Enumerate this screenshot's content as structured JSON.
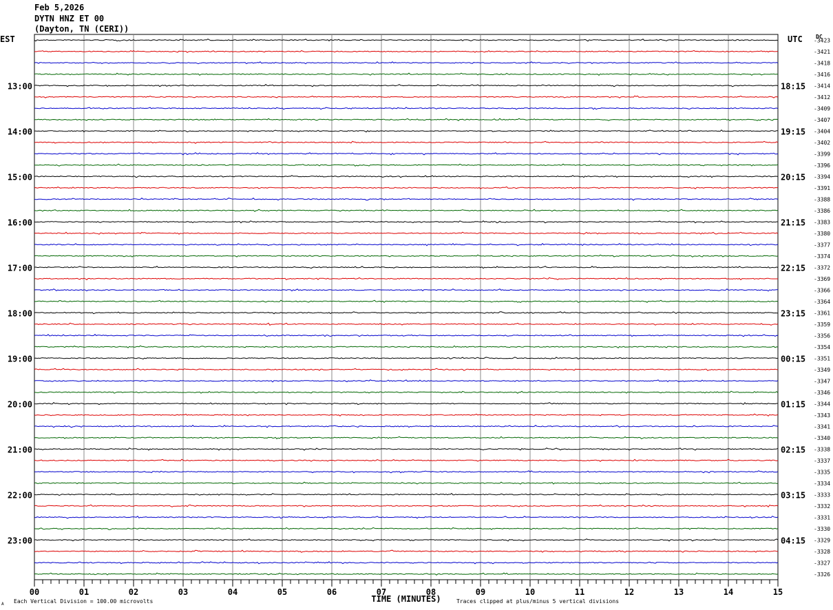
{
  "header": {
    "date": "Feb 5,2026",
    "station": "DYTN HNZ ET 00",
    "location": "(Dayton, TN (CERI))"
  },
  "left_zone_label": "EST",
  "right_zone_label": "UTC",
  "dc_label": "DC",
  "footer": {
    "scale_note": "Each Vertical Division =  100.00 microvolts",
    "clip_note": "Traces clipped at plus/minus 5 vertical divisions",
    "corner_mark": "A"
  },
  "chart_data": {
    "type": "line",
    "title": "DYTN HNZ ET 00",
    "xlabel": "TIME (MINUTES)",
    "ylabel": "",
    "xlim": [
      0,
      15
    ],
    "x_ticks": [
      "00",
      "01",
      "02",
      "03",
      "04",
      "05",
      "06",
      "07",
      "08",
      "09",
      "10",
      "11",
      "12",
      "13",
      "14",
      "15"
    ],
    "grid": true,
    "trace_colors": [
      "#000000",
      "#dd0000",
      "#0000cc",
      "#006600"
    ],
    "left_hour_labels": [
      "13:00",
      "14:00",
      "15:00",
      "16:00",
      "17:00",
      "18:00",
      "19:00",
      "20:00",
      "21:00",
      "22:00",
      "23:00"
    ],
    "right_hour_labels": [
      "18:15",
      "19:15",
      "20:15",
      "21:15",
      "22:15",
      "23:15",
      "00:15",
      "01:15",
      "02:15",
      "03:15",
      "04:15"
    ],
    "dc_offsets": [
      "-3423",
      "-3421",
      "-3418",
      "-3416",
      "-3414",
      "-3412",
      "-3409",
      "-3407",
      "-3404",
      "-3402",
      "-3399",
      "-3396",
      "-3394",
      "-3391",
      "-3388",
      "-3386",
      "-3383",
      "-3380",
      "-3377",
      "-3374",
      "-3372",
      "-3369",
      "-3366",
      "-3364",
      "-3361",
      "-3359",
      "-3356",
      "-3354",
      "-3351",
      "-3349",
      "-3347",
      "-3346",
      "-3344",
      "-3343",
      "-3341",
      "-3340",
      "-3338",
      "-3337",
      "-3335",
      "-3334",
      "-3333",
      "-3332",
      "-3331",
      "-3330",
      "-3329",
      "-3328",
      "-3327",
      "-3326"
    ],
    "trace_count": 48,
    "first_hour_row": 4,
    "rows_per_hour": 4
  }
}
